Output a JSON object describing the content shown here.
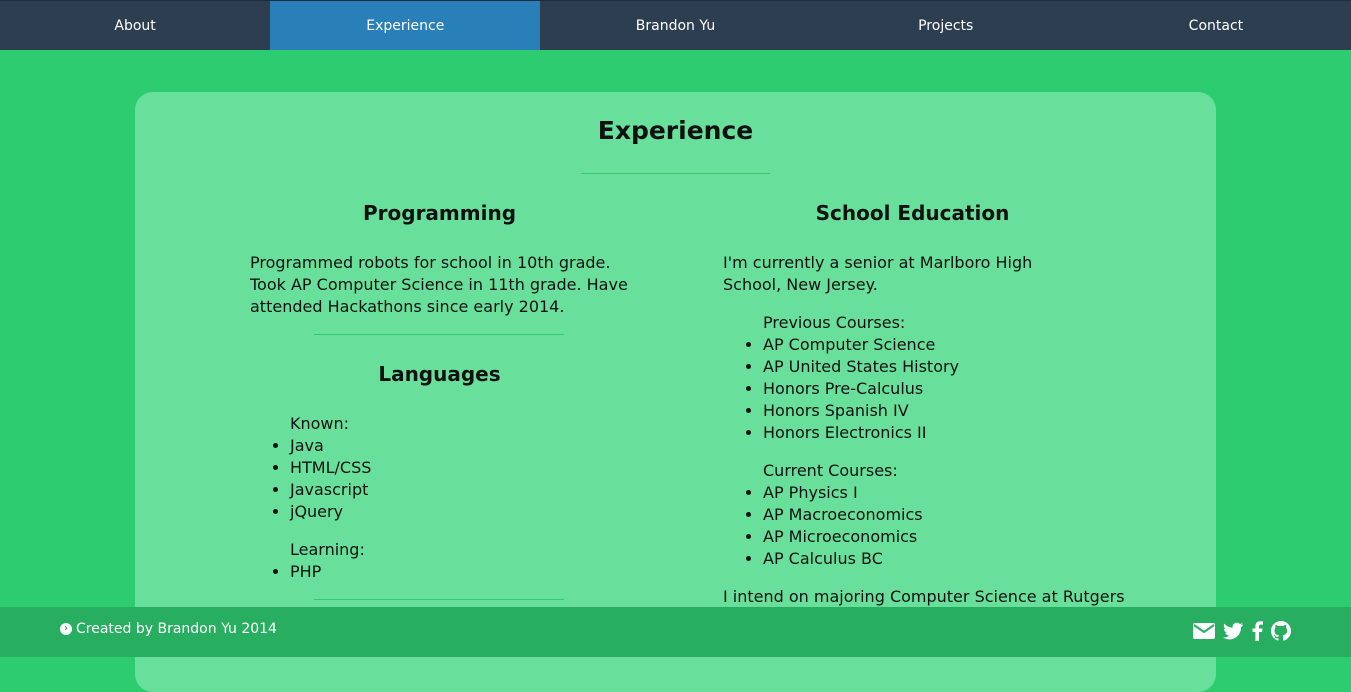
{
  "nav": {
    "items": [
      {
        "label": "About"
      },
      {
        "label": "Experience"
      },
      {
        "label": "Brandon Yu"
      },
      {
        "label": "Projects"
      },
      {
        "label": "Contact"
      }
    ],
    "active": "Experience"
  },
  "main": {
    "title": "Experience",
    "programming": {
      "heading": "Programming",
      "text": "Programmed robots for school in 10th grade. Took AP Computer Science in 11th grade. Have attended Hackathons since early 2014."
    },
    "languages": {
      "heading": "Languages",
      "known_label": "Known:",
      "known": [
        "Java",
        "HTML/CSS",
        "Javascript",
        "jQuery"
      ],
      "learning_label": "Learning:",
      "learning": [
        "PHP"
      ]
    },
    "education": {
      "heading": "School Education",
      "text": "I'm currently a senior at Marlboro High School, New Jersey.",
      "previous_label": "Previous Courses:",
      "previous": [
        "AP Computer Science",
        "AP United States History",
        "Honors Pre-Calculus",
        "Honors Spanish IV",
        "Honors Electronics II"
      ],
      "current_label": "Current Courses:",
      "current": [
        "AP Physics I",
        "AP Macroeconomics",
        "AP Microeconomics",
        "AP Calculus BC"
      ],
      "intent": "I intend on majoring Computer Science at Rutgers"
    }
  },
  "footer": {
    "credit": "Created by Brandon Yu 2014",
    "icons": [
      "envelope-icon",
      "twitter-icon",
      "facebook-icon",
      "github-icon"
    ]
  },
  "colors": {
    "page_bg": "#2ecc71",
    "nav_bg": "#2c3e50",
    "nav_active": "#2980b9",
    "card_bg": "#68e09b",
    "footer_bg": "#27ae60"
  }
}
